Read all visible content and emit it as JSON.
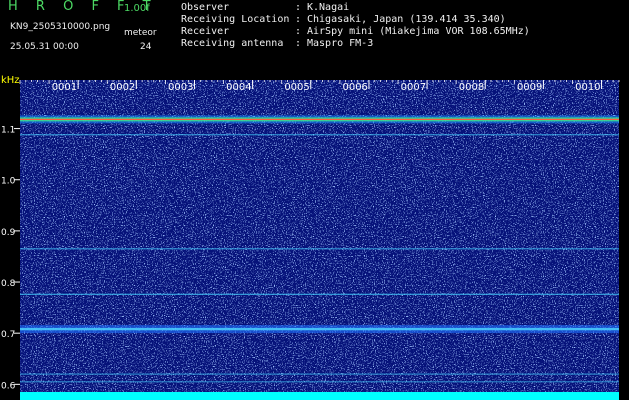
{
  "header": {
    "brand": "H R O F F T",
    "version": "1.00f",
    "filename": "KN9_2505310000.png",
    "meteor_label": "meteor",
    "datetime": "25.05.31 00:00",
    "count": "24"
  },
  "info": [
    {
      "label": "Observer",
      "value": "K.Nagai"
    },
    {
      "label": "Receiving Location",
      "value": "Chigasaki, Japan (139.414 35.340)"
    },
    {
      "label": "Receiver",
      "value": "AirSpy mini (Miakejima VOR 108.65MHz)"
    },
    {
      "label": "Receiving antenna",
      "value": "Maspro FM-3"
    }
  ],
  "colors": {
    "background": "#000000",
    "plot_bg": "#06127a",
    "header_green": "#4cd964",
    "header_text": "#f0f0f0",
    "axis_label": "#ffff00",
    "baseline": "#00ffff"
  },
  "chart_data": {
    "type": "heatmap",
    "ylabel": "kHz",
    "y_ticks": [
      "0.6",
      "0.7",
      "0.8",
      "0.9",
      "1.0",
      "1.1"
    ],
    "y_tick_values": [
      0.6,
      0.7,
      0.8,
      0.9,
      1.0,
      1.1
    ],
    "ylim": [
      0.585,
      1.195
    ],
    "x_ticks": [
      "0001",
      "0002",
      "0003",
      "0004",
      "0005",
      "0006",
      "0007",
      "0008",
      "0009",
      "0010"
    ],
    "xlim": [
      0,
      10.3
    ],
    "bands": [
      {
        "freq": 1.118,
        "intensity": 1.0
      },
      {
        "freq": 1.088,
        "intensity": 0.3
      },
      {
        "freq": 0.865,
        "intensity": 0.3
      },
      {
        "freq": 0.776,
        "intensity": 0.4
      },
      {
        "freq": 0.708,
        "intensity": 0.75
      },
      {
        "freq": 0.62,
        "intensity": 0.25
      },
      {
        "freq": 0.605,
        "intensity": 0.2
      }
    ]
  }
}
